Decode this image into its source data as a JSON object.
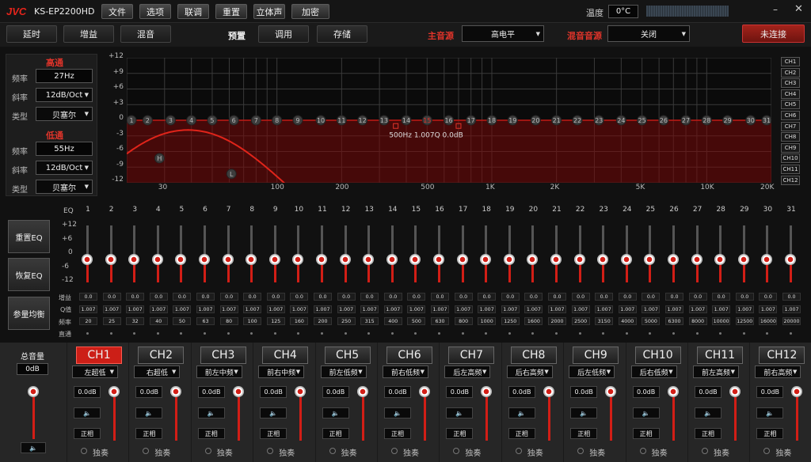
{
  "app": {
    "logo": "JVC",
    "model": "KS-EP2200HD",
    "temp_label": "温度",
    "temp_value": "0°C"
  },
  "menu": [
    "文件",
    "选项",
    "联调",
    "重置",
    "立体声",
    "加密"
  ],
  "toolbar": {
    "left": [
      "延时",
      "增益",
      "混音"
    ],
    "preset_label": "预置",
    "recall": "调用",
    "store": "存储",
    "main_source_label": "主音源",
    "main_source_value": "高电平",
    "mix_source_label": "混音音源",
    "mix_source_value": "关闭",
    "connect": "未连接"
  },
  "crossover": {
    "high_title": "高通",
    "low_title": "低通",
    "labels": {
      "freq": "频率",
      "slope": "斜率",
      "type": "类型"
    },
    "high": {
      "freq": "27Hz",
      "slope": "12dB/Oct",
      "type": "贝塞尔"
    },
    "low": {
      "freq": "55Hz",
      "slope": "12dB/Oct",
      "type": "贝塞尔"
    }
  },
  "graph": {
    "y_ticks": [
      "+12",
      "+9",
      "+6",
      "+3",
      "0",
      "-3",
      "-6",
      "-9",
      "-12"
    ],
    "x_ticks": [
      "30",
      "100",
      "200",
      "500",
      "1K",
      "2K",
      "5K",
      "10K",
      "20K"
    ],
    "readout": "500Hz  1.007Q  0.0dB",
    "h_marker": "H",
    "l_marker": "L",
    "active_band": "15"
  },
  "channel_buttons": [
    "CH1",
    "CH2",
    "CH3",
    "CH4",
    "CH5",
    "CH6",
    "CH7",
    "CH8",
    "CH9",
    "CH10",
    "CH11",
    "CH12"
  ],
  "eq": {
    "header": "EQ",
    "scale": [
      "+12",
      "+6",
      "0",
      "-6",
      "-12"
    ],
    "side": [
      "重置EQ",
      "恢复EQ",
      "参量均衡"
    ],
    "row_labels": [
      "增益",
      "Q值",
      "频率",
      "直通"
    ],
    "gain_db": [
      0,
      0,
      0,
      0,
      0,
      0,
      0,
      0,
      0,
      0,
      0,
      0,
      0,
      0,
      0,
      0,
      0,
      0,
      0,
      0,
      0,
      0,
      0,
      0,
      0,
      0,
      0,
      0,
      0,
      0,
      0
    ],
    "gains": [
      "0.0",
      "0.0",
      "0.0",
      "0.0",
      "0.0",
      "0.0",
      "0.0",
      "0.0",
      "0.0",
      "0.0",
      "0.0",
      "0.0",
      "0.0",
      "0.0",
      "0.0",
      "0.0",
      "0.0",
      "0.0",
      "0.0",
      "0.0",
      "0.0",
      "0.0",
      "0.0",
      "0.0",
      "0.0",
      "0.0",
      "0.0",
      "0.0",
      "0.0",
      "0.0",
      "0.0"
    ],
    "q": [
      "1.007",
      "1.007",
      "1.007",
      "1.007",
      "1.007",
      "1.007",
      "1.007",
      "1.007",
      "1.007",
      "1.007",
      "1.007",
      "1.007",
      "1.007",
      "1.007",
      "1.007",
      "1.007",
      "1.007",
      "1.007",
      "1.007",
      "1.007",
      "1.007",
      "1.007",
      "1.007",
      "1.007",
      "1.007",
      "1.007",
      "1.007",
      "1.007",
      "1.007",
      "1.007",
      "1.007"
    ],
    "freqs": [
      "20",
      "25",
      "32",
      "40",
      "50",
      "63",
      "80",
      "100",
      "125",
      "160",
      "200",
      "250",
      "315",
      "400",
      "500",
      "630",
      "800",
      "1000",
      "1250",
      "1600",
      "2000",
      "2500",
      "3150",
      "4000",
      "5000",
      "6300",
      "8000",
      "10000",
      "12500",
      "16000",
      "20000"
    ]
  },
  "master": {
    "label": "总音量",
    "value": "0dB"
  },
  "channels": [
    {
      "name": "CH1",
      "assign": "左超低",
      "gain": "0.0dB",
      "phase": "正相",
      "solo": "独奏"
    },
    {
      "name": "CH2",
      "assign": "右超低",
      "gain": "0.0dB",
      "phase": "正相",
      "solo": "独奏"
    },
    {
      "name": "CH3",
      "assign": "前左中频",
      "gain": "0.0dB",
      "phase": "正相",
      "solo": "独奏"
    },
    {
      "name": "CH4",
      "assign": "前右中频",
      "gain": "0.0dB",
      "phase": "正相",
      "solo": "独奏"
    },
    {
      "name": "CH5",
      "assign": "前左低频",
      "gain": "0.0dB",
      "phase": "正相",
      "solo": "独奏"
    },
    {
      "name": "CH6",
      "assign": "前右低频",
      "gain": "0.0dB",
      "phase": "正相",
      "solo": "独奏"
    },
    {
      "name": "CH7",
      "assign": "后左高频",
      "gain": "0.0dB",
      "phase": "正相",
      "solo": "独奏"
    },
    {
      "name": "CH8",
      "assign": "后右高频",
      "gain": "0.0dB",
      "phase": "正相",
      "solo": "独奏"
    },
    {
      "name": "CH9",
      "assign": "后左低频",
      "gain": "0.0dB",
      "phase": "正相",
      "solo": "独奏"
    },
    {
      "name": "CH10",
      "assign": "后右低频",
      "gain": "0.0dB",
      "phase": "正相",
      "solo": "独奏"
    },
    {
      "name": "CH11",
      "assign": "前左高频",
      "gain": "0.0dB",
      "phase": "正相",
      "solo": "独奏"
    },
    {
      "name": "CH12",
      "assign": "前右高频",
      "gain": "0.0dB",
      "phase": "正相",
      "solo": "独奏"
    }
  ],
  "active_channel": "CH1",
  "icons": {
    "speaker": "speaker-icon",
    "minimize": "minimize-icon",
    "close": "close-icon"
  },
  "colors": {
    "accent": "#d21e16",
    "bg": "#111111"
  }
}
